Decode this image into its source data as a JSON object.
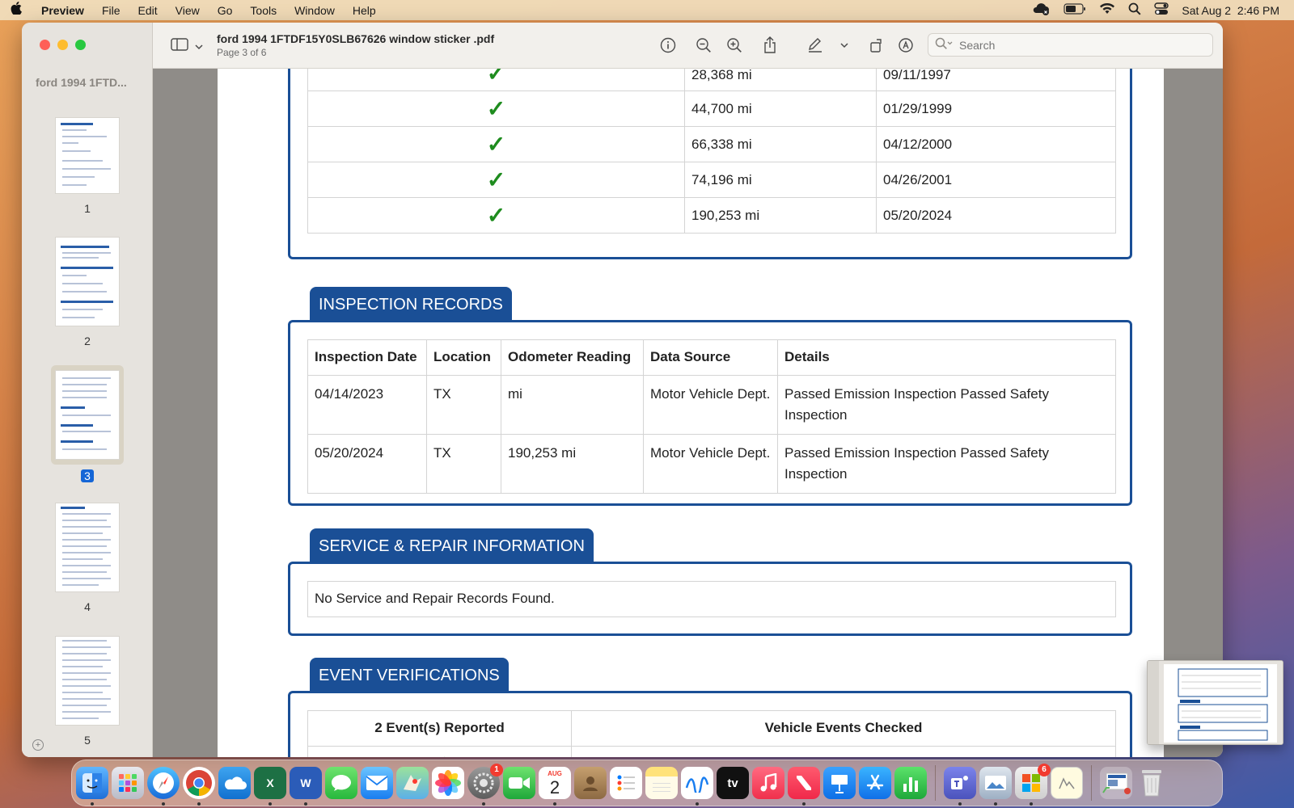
{
  "menubar": {
    "app_name": "Preview",
    "items": [
      "File",
      "Edit",
      "View",
      "Go",
      "Tools",
      "Window",
      "Help"
    ],
    "datetime": "Sat Aug 2  2:46 PM"
  },
  "window": {
    "sidebar_title": "ford 1994 1FTD...",
    "thumbnails": [
      {
        "label": "1"
      },
      {
        "label": "2"
      },
      {
        "label": "3",
        "selected": true
      },
      {
        "label": "4"
      },
      {
        "label": "5"
      }
    ],
    "doc_title": "ford 1994 1FTDF15Y0SLB67626 window sticker .pdf",
    "page_indicator": "Page 3 of 6",
    "search_placeholder": "Search"
  },
  "odometer_rows": [
    {
      "mileage": "28,368 mi",
      "date": "09/11/1997"
    },
    {
      "mileage": "44,700 mi",
      "date": "01/29/1999"
    },
    {
      "mileage": "66,338 mi",
      "date": "04/12/2000"
    },
    {
      "mileage": "74,196 mi",
      "date": "04/26/2001"
    },
    {
      "mileage": "190,253 mi",
      "date": "05/20/2024"
    }
  ],
  "inspection": {
    "title": "INSPECTION RECORDS",
    "headers": [
      "Inspection Date",
      "Location",
      "Odometer Reading",
      "Data Source",
      "Details"
    ],
    "rows": [
      [
        "04/14/2023",
        "TX",
        "mi",
        "Motor Vehicle Dept.",
        "Passed Emission Inspection Passed Safety Inspection"
      ],
      [
        "05/20/2024",
        "TX",
        "190,253 mi",
        "Motor Vehicle Dept.",
        "Passed Emission Inspection Passed Safety Inspection"
      ]
    ]
  },
  "service": {
    "title": "SERVICE & REPAIR INFORMATION",
    "message": "No Service and Repair Records Found."
  },
  "events": {
    "title": "EVENT VERIFICATIONS",
    "headers": [
      "2 Event(s) Reported",
      "Vehicle Events Checked"
    ]
  },
  "dock": {
    "calendar_month": "AUG",
    "calendar_day": "2",
    "settings_badge": "1",
    "office_badge": "6",
    "appletv_label": "tv"
  }
}
